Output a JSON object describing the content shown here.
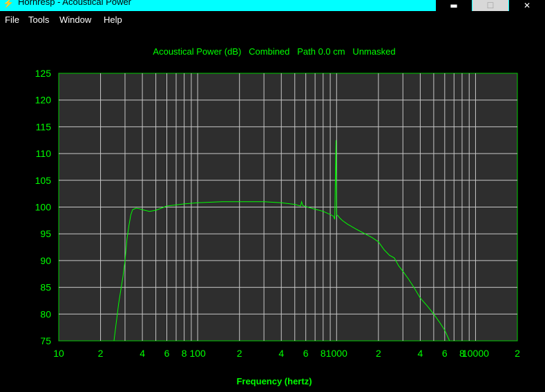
{
  "window": {
    "title": "Hornresp - Acoustical Power",
    "app_icon": "lightning-icon",
    "minimize_glyph": "▬",
    "maximize_glyph": "☐",
    "close_glyph": "✕"
  },
  "menu": {
    "items": [
      {
        "label": "File"
      },
      {
        "label": "Tools"
      },
      {
        "label": "Window"
      },
      {
        "label": "Help"
      }
    ]
  },
  "colors": {
    "background": "#000000",
    "plot_bg": "#2e2e2e",
    "grid": "#c8c8c8",
    "accent": "#00ff00",
    "titlebar": "#00ffff"
  },
  "chart_data": {
    "type": "line",
    "title": "Acoustical Power (dB)   Combined   Path 0.0 cm   Unmasked",
    "xlabel": "Frequency (hertz)",
    "ylabel": "",
    "xscale": "log",
    "xlim": [
      10,
      20000
    ],
    "ylim": [
      75,
      125
    ],
    "grid": true,
    "y_ticks": [
      "125",
      "120",
      "115",
      "110",
      "105",
      "100",
      "95",
      "90",
      "85",
      "80",
      "75"
    ],
    "x_ticks": [
      {
        "x": 10,
        "label": "10"
      },
      {
        "x": 20,
        "label": "2"
      },
      {
        "x": 40,
        "label": "4"
      },
      {
        "x": 60,
        "label": "6"
      },
      {
        "x": 80,
        "label": "8"
      },
      {
        "x": 100,
        "label": "100"
      },
      {
        "x": 200,
        "label": "2"
      },
      {
        "x": 400,
        "label": "4"
      },
      {
        "x": 600,
        "label": "6"
      },
      {
        "x": 800,
        "label": "8"
      },
      {
        "x": 1000,
        "label": "1000"
      },
      {
        "x": 2000,
        "label": "2"
      },
      {
        "x": 4000,
        "label": "4"
      },
      {
        "x": 6000,
        "label": "6"
      },
      {
        "x": 8000,
        "label": "8"
      },
      {
        "x": 10000,
        "label": "10000"
      },
      {
        "x": 20000,
        "label": "2"
      }
    ],
    "series": [
      {
        "x": [
          25,
          27,
          29,
          30,
          31,
          32,
          33,
          34,
          36,
          38,
          40,
          45,
          50,
          60,
          80,
          100,
          150,
          200,
          300,
          400,
          500,
          550,
          560,
          570,
          600,
          700,
          800,
          900,
          950,
          970,
          990,
          1000,
          1010,
          1030,
          1050,
          1100,
          1200,
          1400,
          1600,
          1800,
          2000,
          2200,
          2400,
          2600,
          2800,
          3000,
          3300,
          3600,
          4000,
          4500,
          5000,
          5500,
          6000,
          6500
        ],
        "y": [
          75,
          82,
          87,
          90,
          94,
          96.5,
          98.5,
          99.5,
          99.8,
          99.7,
          99.5,
          99.2,
          99.4,
          100.2,
          100.6,
          100.8,
          101.0,
          101.0,
          101.0,
          100.8,
          100.5,
          100.2,
          101.0,
          100.3,
          100.1,
          99.6,
          99.2,
          98.6,
          98.3,
          97.7,
          112.5,
          98.5,
          98.5,
          98.3,
          98.0,
          97.5,
          96.8,
          95.8,
          95.0,
          94.3,
          93.5,
          92.0,
          91.0,
          90.5,
          89.0,
          88.0,
          86.5,
          85.0,
          83.0,
          81.5,
          80.0,
          78.5,
          77.0,
          75.0
        ]
      }
    ]
  }
}
